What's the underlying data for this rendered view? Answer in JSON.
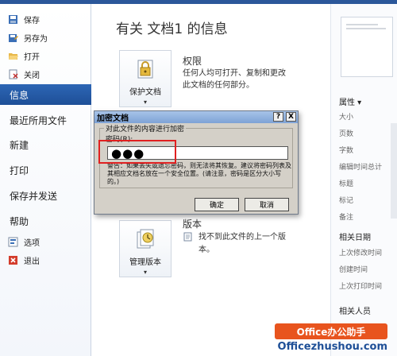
{
  "sidebar": {
    "small_items": [
      {
        "label": "保存",
        "icon": "save-icon"
      },
      {
        "label": "另存为",
        "icon": "save-as-icon"
      },
      {
        "label": "打开",
        "icon": "folder-open-icon"
      },
      {
        "label": "关闭",
        "icon": "close-doc-icon"
      }
    ],
    "active_label": "信息",
    "big_items": [
      "最近所用文件",
      "新建",
      "打印",
      "保存并发送",
      "帮助"
    ],
    "bottom_items": [
      {
        "label": "选项",
        "icon": "options-icon"
      },
      {
        "label": "退出",
        "icon": "exit-icon"
      }
    ]
  },
  "main": {
    "title": "有关 文档1 的信息",
    "protect": {
      "button_label": "保护文档",
      "heading": "权限",
      "desc_line1": "任何人均可打开、复制和更改",
      "desc_line2": "此文档的任何部分。"
    },
    "versions": {
      "button_label": "管理版本",
      "heading": "版本",
      "desc_line1": "找不到此文件的上一个版",
      "desc_line2": "本。"
    }
  },
  "right": {
    "properties_label": "属性",
    "properties": [
      "大小",
      "页数",
      "字数",
      "编辑时间总计",
      "标题",
      "标记",
      "备注"
    ],
    "dates_label": "相关日期",
    "dates": [
      "上次修改时间",
      "创建时间",
      "上次打印时间"
    ],
    "people_label": "相关人员"
  },
  "dialog": {
    "title": "加密文档",
    "help": "?",
    "close": "X",
    "group_label": "对此文件的内容进行加密",
    "password_label": "密码(R):",
    "password_value": "●●●",
    "warning": "警告：如果丢失或遗忘密码，则无法将其恢复。建议将密码列表及其相应文档名放在一个安全位置。(请注意，密码是区分大小写的。)",
    "ok_label": "确定",
    "cancel_label": "取消"
  },
  "watermark": {
    "badge": "Office办公助手",
    "url": "Officezhushou.com"
  },
  "colors": {
    "accent": "#1e4f97",
    "highlight": "#e02020",
    "watermark": "#e8541e"
  }
}
